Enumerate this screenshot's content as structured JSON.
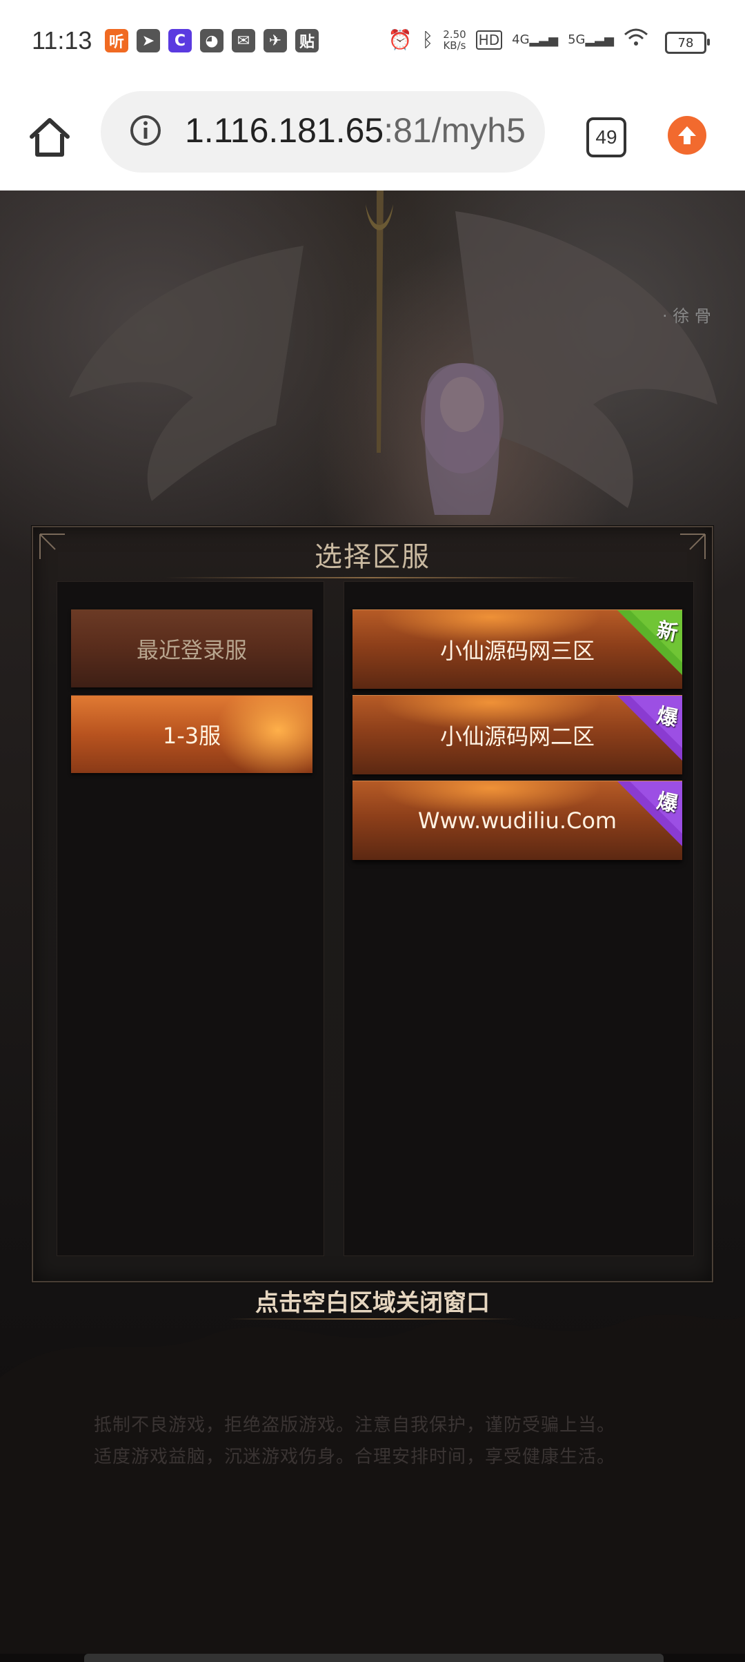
{
  "status_bar": {
    "time": "11:13",
    "net_speed_value": "2.50",
    "net_speed_unit": "KB/s",
    "hd_label": "HD",
    "network_4g": "4G",
    "network_5g": "5G",
    "battery": "78",
    "notif_icons": [
      {
        "name": "app-ting-icon",
        "glyph": "听",
        "color": "#f06a22"
      },
      {
        "name": "telegram-icon",
        "glyph": "➤",
        "color": "#555555"
      },
      {
        "name": "app-c-icon",
        "glyph": "C",
        "color": "#5a3ae0"
      },
      {
        "name": "app-penguin-icon",
        "glyph": "◕",
        "color": "#555555"
      },
      {
        "name": "mail-icon",
        "glyph": "✉",
        "color": "#555555"
      },
      {
        "name": "bird-icon",
        "glyph": "✈",
        "color": "#555555"
      },
      {
        "name": "app-tie-icon",
        "glyph": "贴",
        "color": "#555555"
      }
    ]
  },
  "browser": {
    "url_host": "1.116.181.65",
    "url_rest": ":81/myh5",
    "tab_count": "49"
  },
  "dialog": {
    "title": "选择区服",
    "tabs": [
      {
        "label": "最近登录服"
      },
      {
        "label": "1-3服"
      }
    ],
    "servers": [
      {
        "label": "小仙源码网三区",
        "badge": "新",
        "badge_color": "#5bb32a"
      },
      {
        "label": "小仙源码网二区",
        "badge": "爆",
        "badge_color": "#8a3bd1"
      },
      {
        "label": "Www.wudiliu.Com",
        "badge": "爆",
        "badge_color": "#8a3bd1"
      }
    ],
    "close_hint": "点击空白区域关闭窗口"
  },
  "notice": {
    "line1": "抵制不良游戏，拒绝盗版游戏。注意自我保护，谨防受骗上当。",
    "line2": "适度游戏益脑，沉迷游戏伤身。合理安排时间，享受健康生活。"
  }
}
